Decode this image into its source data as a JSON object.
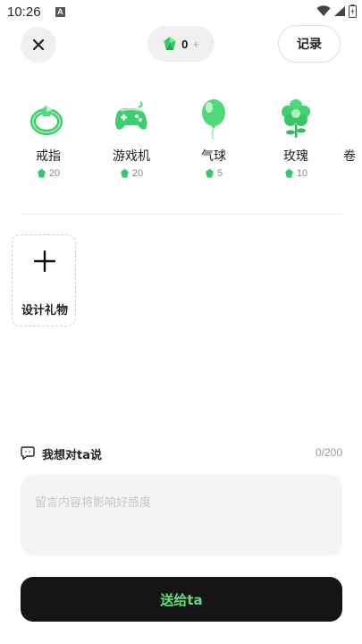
{
  "status_bar": {
    "time": "10:26",
    "notification_glyph": "A"
  },
  "header": {
    "gem_balance": "0",
    "gem_add_glyph": "+",
    "records_label": "记录"
  },
  "gifts": [
    {
      "name": "戒指",
      "price": "20",
      "icon": "ring-icon"
    },
    {
      "name": "游戏机",
      "price": "20",
      "icon": "game-controller-icon"
    },
    {
      "name": "气球",
      "price": "5",
      "icon": "balloon-icon"
    },
    {
      "name": "玫瑰",
      "price": "10",
      "icon": "flower-icon"
    },
    {
      "name": "卷",
      "price": "",
      "icon": "partial-gift-icon"
    }
  ],
  "design_gift": {
    "label": "设计礼物"
  },
  "message": {
    "title": "我想对ta说",
    "counter": "0/200",
    "placeholder": "留言内容将影响好感度"
  },
  "send_button": {
    "label": "送给ta"
  },
  "colors": {
    "accent_green": "#5fe07a",
    "gem_green": "#34c86a",
    "button_dark": "#151515"
  }
}
